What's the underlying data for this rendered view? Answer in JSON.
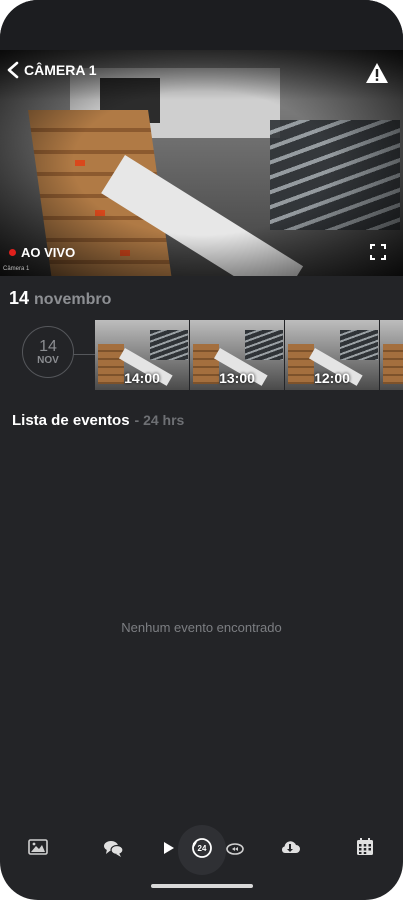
{
  "camera": {
    "title": "CÂMERA 1",
    "live_label": "AO VIVO",
    "overlay_label": "Câmera 1",
    "live_color": "#e0201c"
  },
  "date_header": {
    "day": "14",
    "month": "novembro"
  },
  "timeline": {
    "date_day": "14",
    "date_month": "NOV",
    "thumbnails": [
      {
        "time": "14:00"
      },
      {
        "time": "13:00"
      },
      {
        "time": "12:00"
      },
      {
        "time": ""
      }
    ]
  },
  "events": {
    "title": "Lista de eventos",
    "range": "- 24 hrs",
    "empty_text": "Nenhum evento encontrado"
  },
  "toolbar": {
    "items": [
      {
        "icon": "image-gallery-icon"
      },
      {
        "icon": "chat-icon"
      },
      {
        "icon": "play-icon"
      },
      {
        "icon": "24h-replay-icon"
      },
      {
        "icon": "rewind-icon"
      },
      {
        "icon": "cloud-download-icon"
      },
      {
        "icon": "calendar-icon"
      }
    ]
  },
  "colors": {
    "background": "#232427",
    "muted_text": "#8d8f93",
    "accent_live": "#e0201c"
  }
}
